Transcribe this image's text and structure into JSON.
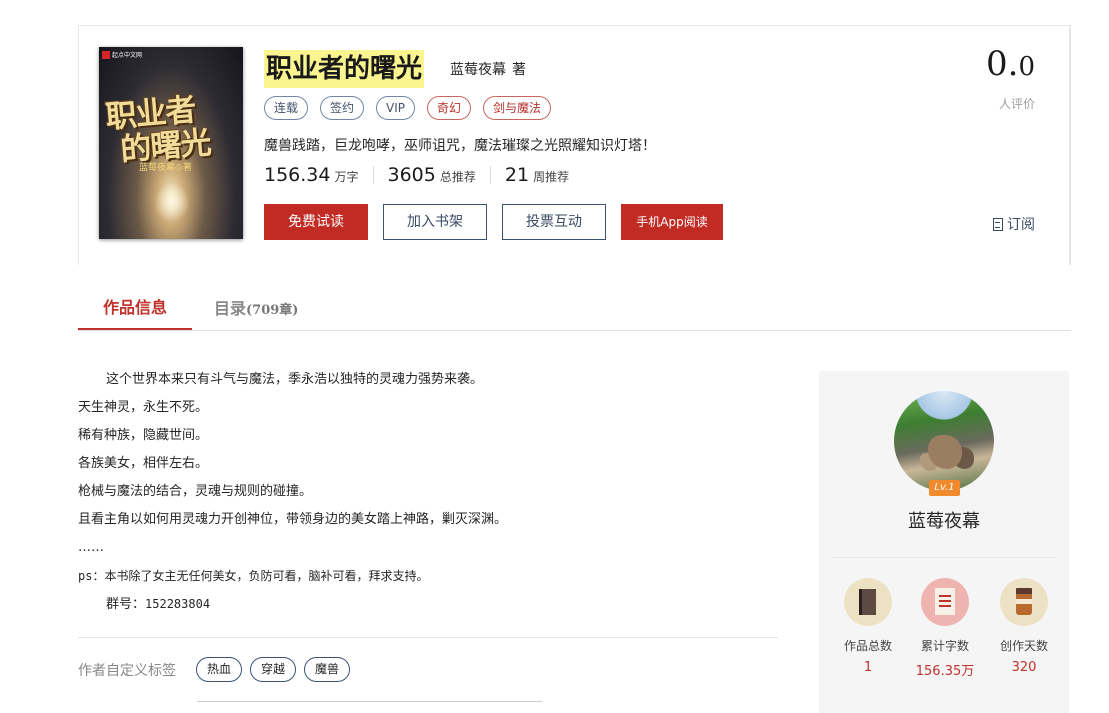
{
  "book": {
    "title": "职业者的曙光",
    "author": "蓝莓夜幕",
    "author_suffix": "著",
    "tags": [
      "连载",
      "签约",
      "VIP",
      "奇幻",
      "剑与魔法"
    ],
    "intro": "魔兽践踏，巨龙咆哮，巫师诅咒，魔法璀璨之光照耀知识灯塔！",
    "stats": {
      "words": "156.34",
      "words_unit": "万字",
      "total_rec": "3605",
      "total_rec_unit": "总推荐",
      "week_rec": "21",
      "week_rec_unit": "周推荐"
    },
    "buttons": {
      "read": "免费试读",
      "shelf": "加入书架",
      "vote": "投票互动",
      "app": "手机App阅读"
    },
    "score_int": "0.",
    "score_dec": "0",
    "score_label": "人评价",
    "subscribe": "订阅"
  },
  "cover": {
    "publisher": "起点中文网",
    "title_line1": "职业者",
    "title_line2": "的曙光",
    "author": "蓝莓夜幕◎著"
  },
  "tabs": {
    "info": "作品信息",
    "catalog": "目录",
    "catalog_count": "(709章)"
  },
  "description": {
    "lines": [
      "这个世界本来只有斗气与魔法，季永浩以独特的灵魂力强势来袭。",
      "天生神灵，永生不死。",
      "稀有种族，隐藏世间。",
      "各族美女，相伴左右。",
      "枪械与魔法的结合，灵魂与规则的碰撞。",
      "且看主角以如何用灵魂力开创神位，带领身边的美女踏上神路，剿灭深渊。",
      "……",
      "ps：本书除了女主无任何美女，负防可看，脑补可看，拜求支持。"
    ],
    "group_label": "群号：",
    "group_number": "152283804"
  },
  "custom_tags": {
    "label": "作者自定义标签",
    "items": [
      "热血",
      "穿越",
      "魔兽"
    ]
  },
  "author_panel": {
    "level": "Lv.1",
    "name": "蓝莓夜幕",
    "stats": [
      {
        "label": "作品总数",
        "value": "1",
        "icon": "book-icon"
      },
      {
        "label": "累计字数",
        "value": "156.35万",
        "icon": "document-icon"
      },
      {
        "label": "创作天数",
        "value": "320",
        "icon": "coffee-cup-icon"
      }
    ]
  },
  "colors": {
    "accent_red": "#c22b24",
    "title_highlight": "#fbf590",
    "navy": "#3a5378"
  }
}
